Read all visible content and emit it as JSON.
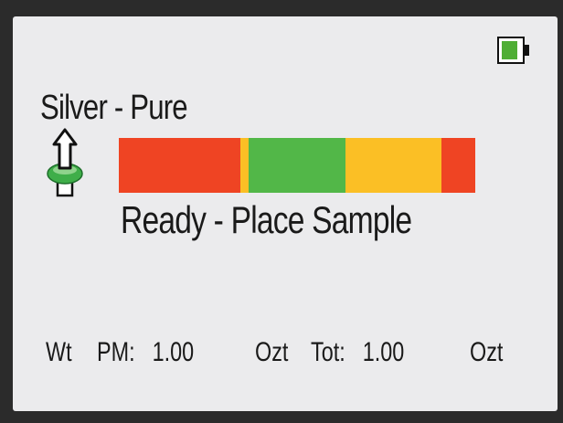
{
  "battery": {
    "level": 0.75,
    "color": "#4fae35"
  },
  "material": {
    "title": "Silver - Pure"
  },
  "sample_icon": {
    "name": "sample-position-icon",
    "accent_color": "#3fae49"
  },
  "range_bar": {
    "segments": [
      {
        "color": "#ef4423",
        "fraction": 0.34
      },
      {
        "color": "#fbbf25",
        "fraction": 0.025
      },
      {
        "color": "#52b748",
        "fraction": 0.27
      },
      {
        "color": "#fbbf25",
        "fraction": 0.27
      },
      {
        "color": "#ef4423",
        "fraction": 0.095
      }
    ]
  },
  "status": {
    "text": "Ready - Place Sample"
  },
  "readout": {
    "weight_label": "Wt",
    "pm_label": "PM:",
    "pm_value": "1.00",
    "pm_unit": "Ozt",
    "tot_label": "Tot:",
    "tot_value": "1.00",
    "tot_unit": "Ozt"
  }
}
